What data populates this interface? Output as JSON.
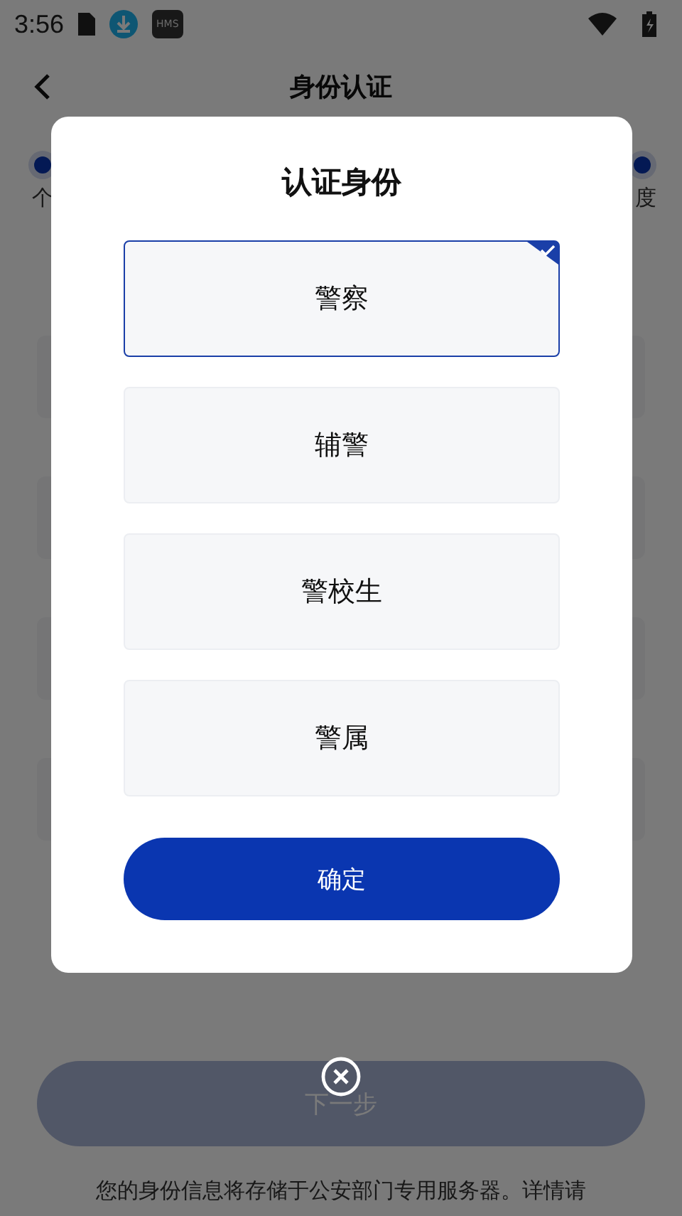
{
  "status_bar": {
    "time": "3:56",
    "badge": "HMS"
  },
  "header": {
    "title": "身份认证"
  },
  "steps": [
    {
      "label": "个"
    },
    {
      "label": "度"
    }
  ],
  "next_button": "下一步",
  "footer_note": "您的身份信息将存储于公安部门专用服务器。详情请",
  "dialog": {
    "title": "认证身份",
    "options": [
      {
        "label": "警察",
        "selected": true
      },
      {
        "label": "辅警",
        "selected": false
      },
      {
        "label": "警校生",
        "selected": false
      },
      {
        "label": "警属",
        "selected": false
      }
    ],
    "confirm": "确定"
  }
}
